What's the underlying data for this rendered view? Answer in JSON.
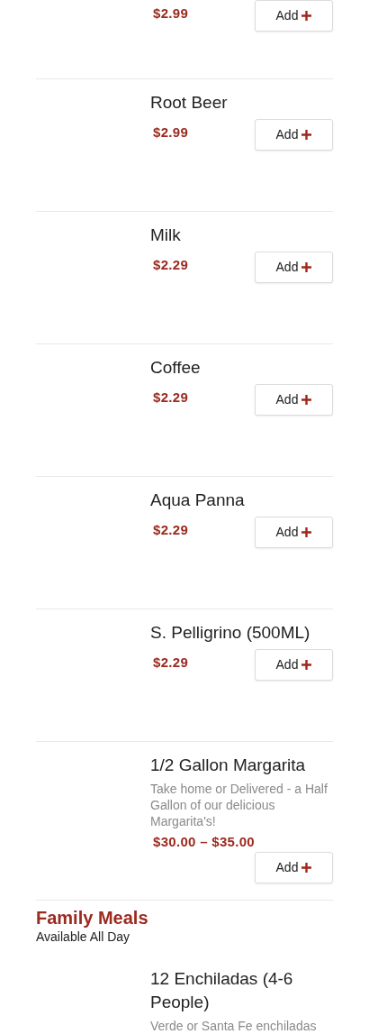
{
  "items": [
    {
      "price": "$2.99",
      "button": "Add"
    },
    {
      "title": "Root Beer",
      "price": "$2.99",
      "button": "Add"
    },
    {
      "title": "Milk",
      "price": "$2.29",
      "button": "Add"
    },
    {
      "title": "Coffee",
      "price": "$2.29",
      "button": "Add"
    },
    {
      "title": "Aqua Panna",
      "price": "$2.29",
      "button": "Add"
    },
    {
      "title": "S. Pelligrino (500ML)",
      "price": "$2.29",
      "button": "Add"
    },
    {
      "title": "1/2 Gallon Margarita",
      "description": "Take home or Delivered - a Half Gallon of our delicious Margarita's!",
      "price": "$30.00 – $35.00",
      "button": "Add"
    }
  ],
  "section": {
    "title": "Family Meals",
    "subtitle": "Available All Day",
    "items": [
      {
        "title": "12 Enchiladas (4-6 People)",
        "description": "Verde or Santa Fe enchiladas"
      }
    ]
  }
}
